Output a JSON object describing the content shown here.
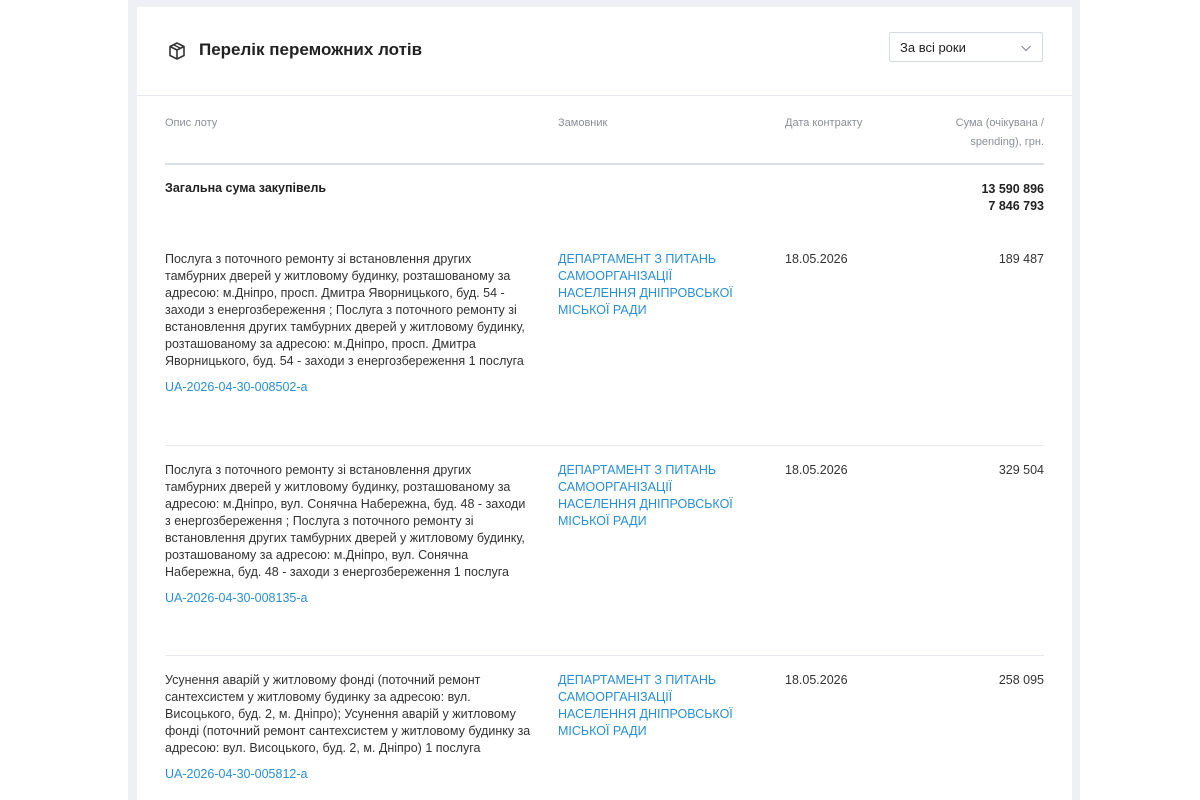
{
  "header": {
    "title": "Перелік переможних лотів",
    "year_select": "За всі роки"
  },
  "table": {
    "columns": {
      "description": "Опис лоту",
      "customer": "Замовник",
      "date": "Дата контракту",
      "sum": "Сума (очікувана / spending), грн."
    },
    "total": {
      "label": "Загальна сума закупівель",
      "expected": "13 590 896",
      "spending": "7 846 793"
    },
    "rows": [
      {
        "description": "Послуга з поточного ремонту зі встановлення других тамбурних дверей у житловому будинку, розташованому за адресою: м.Дніпро, просп. Дмитра Яворницького, буд. 54 - заходи з енергозбереження ; Послуга з поточного ремонту зі встановлення других тамбурних дверей у житловому будинку, розташованому за адресою: м.Дніпро, просп. Дмитра Яворницького, буд. 54 - заходи з енергозбереження 1 послуга",
        "id": "UA-2026-04-30-008502-a",
        "customer": "ДЕПАРТАМЕНТ З ПИТАНЬ САМООРГАНІЗАЦІЇ НАСЕЛЕННЯ ДНІПРОВСЬКОЇ МІСЬКОЇ РАДИ",
        "date": "18.05.2026",
        "sum": "189 487"
      },
      {
        "description": "Послуга з поточного ремонту зі встановлення других тамбурних дверей у житловому будинку, розташованому за адресою: м.Дніпро, вул. Сонячна Набережна, буд. 48 - заходи з енергозбереження ; Послуга з поточного ремонту зі встановлення других тамбурних дверей у житловому будинку, розташованому за адресою: м.Дніпро, вул. Сонячна Набережна, буд. 48 - заходи з енергозбереження 1 послуга",
        "id": "UA-2026-04-30-008135-a",
        "customer": "ДЕПАРТАМЕНТ З ПИТАНЬ САМООРГАНІЗАЦІЇ НАСЕЛЕННЯ ДНІПРОВСЬКОЇ МІСЬКОЇ РАДИ",
        "date": "18.05.2026",
        "sum": "329 504"
      },
      {
        "description": "Усунення аварій у житловому фонді (поточний ремонт сантехсистем у житловому будинку за адресою: вул. Висоцького, буд. 2, м. Дніпро); Усунення аварій у житловому фонді (поточний ремонт сантехсистем у житловому будинку за адресою: вул. Висоцького, буд. 2, м. Дніпро) 1 послуга",
        "id": "UA-2026-04-30-005812-a",
        "customer": "ДЕПАРТАМЕНТ З ПИТАНЬ САМООРГАНІЗАЦІЇ НАСЕЛЕННЯ ДНІПРОВСЬКОЇ МІСЬКОЇ РАДИ",
        "date": "18.05.2026",
        "sum": "258 095"
      }
    ]
  }
}
